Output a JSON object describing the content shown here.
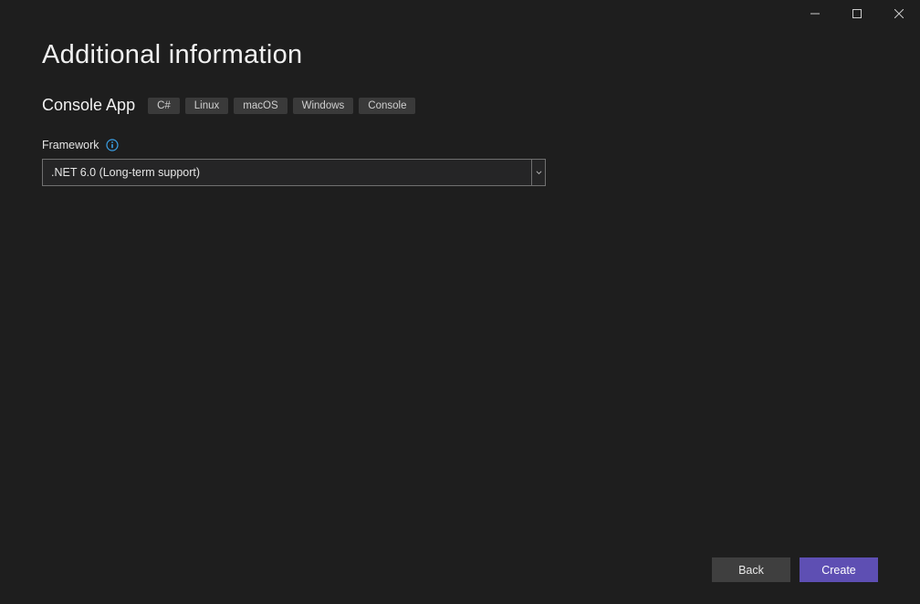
{
  "window": {
    "title": "Additional information"
  },
  "project": {
    "type_name": "Console App",
    "tags": [
      "C#",
      "Linux",
      "macOS",
      "Windows",
      "Console"
    ]
  },
  "framework": {
    "label": "Framework",
    "selected": ".NET 6.0 (Long-term support)"
  },
  "buttons": {
    "back": "Back",
    "create": "Create"
  }
}
